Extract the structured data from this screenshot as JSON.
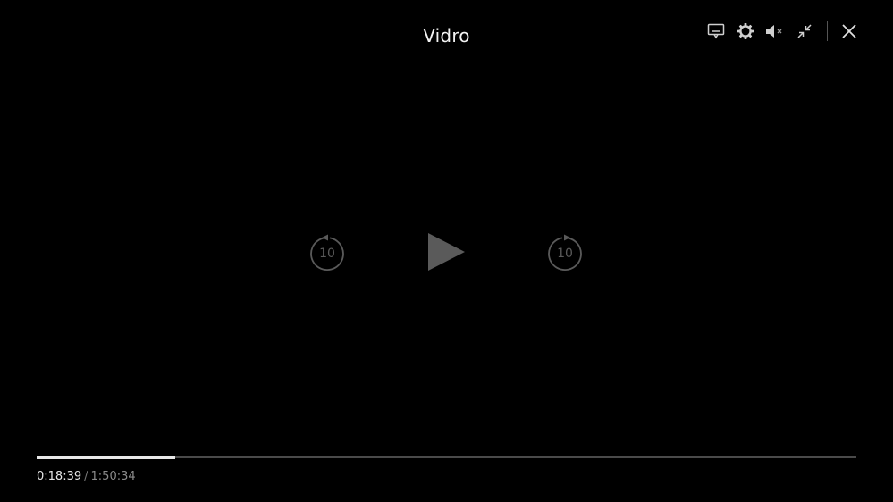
{
  "player": {
    "title": "Vidro",
    "skip_back_label": "10",
    "skip_forward_label": "10",
    "progress_fraction": 0.1686,
    "current_time": "0:18:39",
    "time_separator": "/",
    "total_time": "1:50:34"
  },
  "icons": {
    "subtitles": "subtitles-icon",
    "settings": "gear-icon",
    "volume": "volume-muted-icon",
    "exit_fullscreen": "exit-fullscreen-icon",
    "close": "close-icon",
    "skip_back": "replay-10-icon",
    "play": "play-icon",
    "skip_forward": "forward-10-icon"
  },
  "colors": {
    "background": "#000000",
    "progress_fill": "#e8e8e8",
    "progress_track": "#4a4a4a",
    "center_controls": "#5a5a5a"
  }
}
